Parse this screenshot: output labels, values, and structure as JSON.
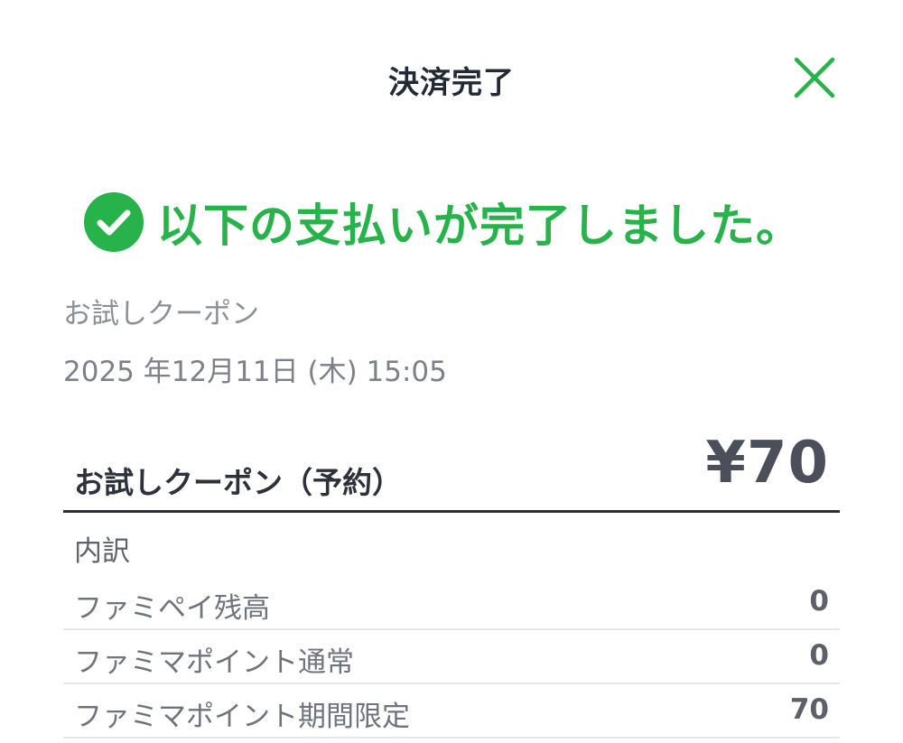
{
  "header": {
    "title": "決済完了",
    "close_icon": "close-icon",
    "accent_color": "#27b24a"
  },
  "success": {
    "icon": "check-circle-icon",
    "message": "以下の支払いが完了しました。",
    "color": "#27b24a"
  },
  "transaction": {
    "name": "お試しクーポン",
    "datetime": "2025 年12月11日 (木) 15:05"
  },
  "item": {
    "name": "お試しクーポン（予約）",
    "amount": "¥70"
  },
  "breakdown": {
    "label": "内訳",
    "rows": [
      {
        "label": "ファミペイ残高",
        "value": "0"
      },
      {
        "label": "ファミマポイント通常",
        "value": "0"
      },
      {
        "label": "ファミマポイント期間限定",
        "value": "70"
      }
    ]
  }
}
